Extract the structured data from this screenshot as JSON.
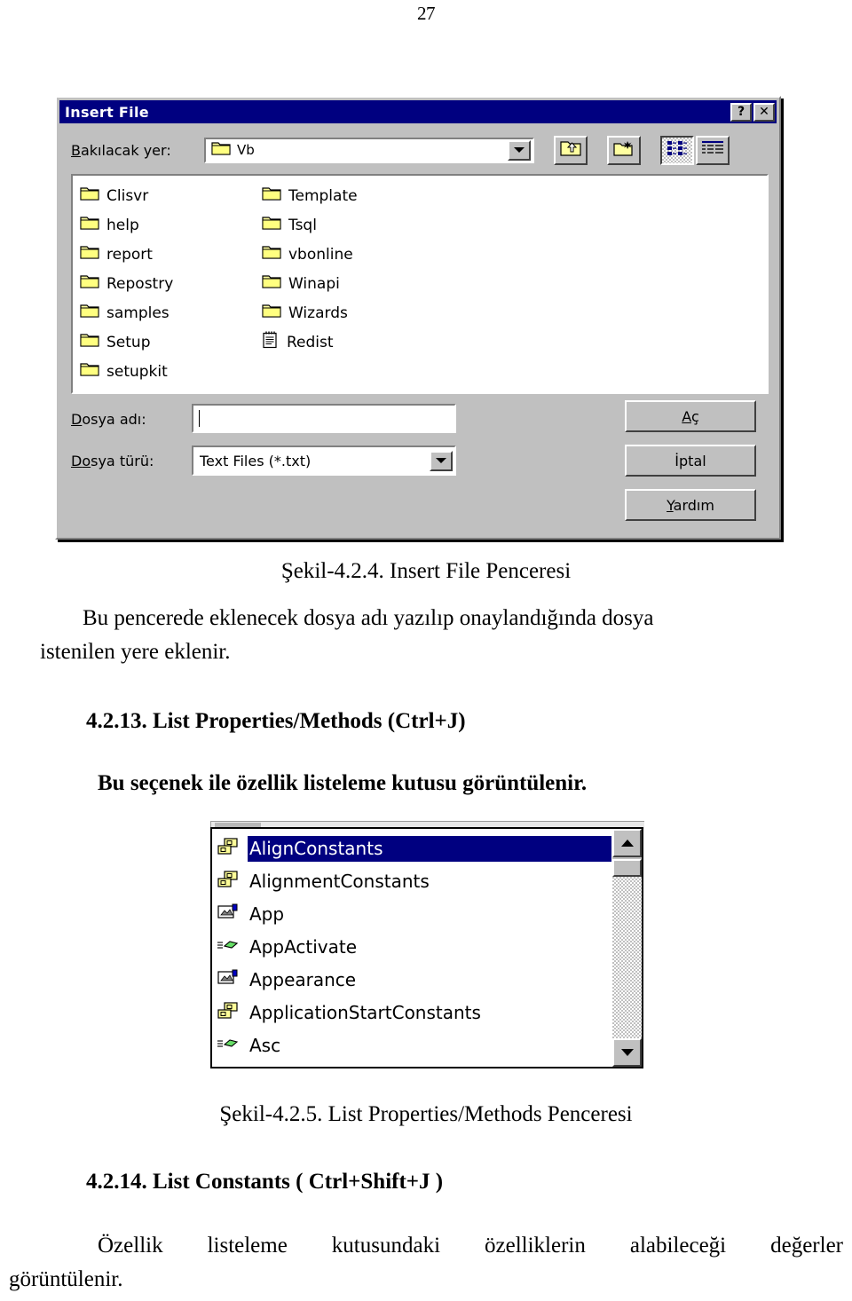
{
  "page": {
    "number": "27"
  },
  "insert_file_dialog": {
    "title": "Insert File",
    "help_button": "?",
    "close_button": "✕",
    "lookin_label_pre": "B",
    "lookin_label_post": "akılacak yer:",
    "lookin_value": "Vb",
    "toolbar": {
      "up_one_level": "up-one-level",
      "create_new_folder": "create-new-folder",
      "list_view": "list-view",
      "details_view": "details-view"
    },
    "files": [
      {
        "name": "Clisvr",
        "icon": "folder-icon"
      },
      {
        "name": "help",
        "icon": "folder-icon"
      },
      {
        "name": "report",
        "icon": "folder-icon"
      },
      {
        "name": "Repostry",
        "icon": "folder-icon"
      },
      {
        "name": "samples",
        "icon": "folder-icon"
      },
      {
        "name": "Setup",
        "icon": "folder-icon"
      },
      {
        "name": "setupkit",
        "icon": "folder-icon"
      },
      {
        "name": "Template",
        "icon": "folder-icon"
      },
      {
        "name": "Tsql",
        "icon": "folder-icon"
      },
      {
        "name": "vbonline",
        "icon": "folder-icon"
      },
      {
        "name": "Winapi",
        "icon": "folder-icon"
      },
      {
        "name": "Wizards",
        "icon": "folder-icon"
      },
      {
        "name": "Redist",
        "icon": "text-file-icon"
      }
    ],
    "filename_label_pre": "D",
    "filename_label_post": "osya adı:",
    "filename_value": "",
    "filetype_label_pre": "D",
    "filetype_label_mid": "o",
    "filetype_label_post": "sya türü:",
    "filetype_value": "Text Files (*.txt)",
    "buttons": {
      "open_pre": "A",
      "open_post": "ç",
      "cancel": "İptal",
      "help_pre": "Y",
      "help_post": "ardım"
    }
  },
  "document": {
    "figure_caption_1": "Şekil-4.2.4. Insert File Penceresi",
    "paragraph_1_line1": "Bu pencerede eklenecek dosya adı yazılıp onaylandığında dosya",
    "paragraph_1_line2": "istenilen yere eklenir.",
    "heading_1": "4.2.13. List Properties/Methods (Ctrl+J)",
    "paragraph_2": "Bu seçenek ile özellik listeleme kutusu görüntülenir.",
    "figure_caption_2": "Şekil-4.2.5. List Properties/Methods Penceresi",
    "heading_2": "4.2.14. List Constants ( Ctrl+Shift+J )",
    "paragraph_3_line1": "Özellik listeleme kutusundaki özelliklerin alabileceği değerler",
    "paragraph_3_line2": "görüntülenir."
  },
  "list_properties_window": {
    "items": [
      {
        "label": "AlignConstants",
        "icon": "enum-constants-icon",
        "selected": true
      },
      {
        "label": "AlignmentConstants",
        "icon": "enum-constants-icon",
        "selected": false
      },
      {
        "label": "App",
        "icon": "property-icon",
        "selected": false
      },
      {
        "label": "AppActivate",
        "icon": "method-icon",
        "selected": false
      },
      {
        "label": "Appearance",
        "icon": "property-icon",
        "selected": false
      },
      {
        "label": "ApplicationStartConstants",
        "icon": "enum-constants-icon",
        "selected": false
      },
      {
        "label": "Asc",
        "icon": "method-icon",
        "selected": false
      }
    ],
    "scrollbar": {
      "up_arrow": "scroll-up-icon",
      "down_arrow": "scroll-down-icon"
    }
  },
  "colors": {
    "titlebar": "#000080",
    "dialog_face": "#c0c0c0",
    "selection": "#000080",
    "folder_yellow": "#ffffa0"
  }
}
